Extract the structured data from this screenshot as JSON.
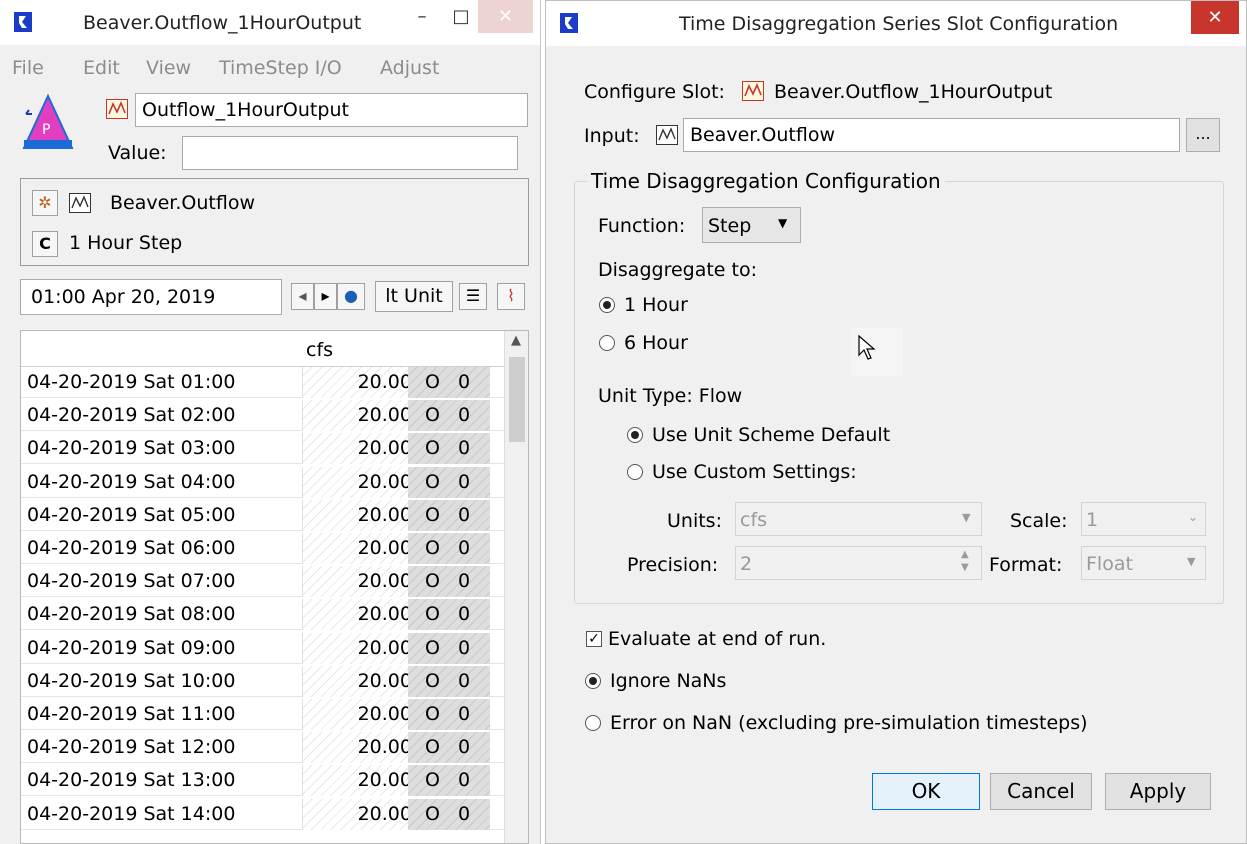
{
  "left_window": {
    "title": "Beaver.Outflow_1HourOutput",
    "controls": {
      "minimize": "–",
      "maximize": "□",
      "close": "✕"
    },
    "menu": [
      "File",
      "Edit",
      "View",
      "TimeStep I/O",
      "Adjust"
    ],
    "slot_name": "Outflow_1HourOutput",
    "value_label": "Value:",
    "value": "",
    "source_slot": "Beaver.Outflow",
    "timestep": "1 Hour Step",
    "date": "01:00 Apr 20, 2019",
    "alt_unit_button": "lt Unit",
    "icons": [
      "gear-icon",
      "series-slot-icon",
      "refresh-icon",
      "nav-left-icon",
      "nav-right-icon",
      "globe-icon",
      "list-icon",
      "plot-icon"
    ],
    "grid": {
      "unit_header": "cfs",
      "rows": [
        {
          "date": "04-20-2019 Sat 01:00",
          "value": "20.00",
          "flag1": "O",
          "flag2": "0"
        },
        {
          "date": "04-20-2019 Sat 02:00",
          "value": "20.00",
          "flag1": "O",
          "flag2": "0"
        },
        {
          "date": "04-20-2019 Sat 03:00",
          "value": "20.00",
          "flag1": "O",
          "flag2": "0"
        },
        {
          "date": "04-20-2019 Sat 04:00",
          "value": "20.00",
          "flag1": "O",
          "flag2": "0"
        },
        {
          "date": "04-20-2019 Sat 05:00",
          "value": "20.00",
          "flag1": "O",
          "flag2": "0"
        },
        {
          "date": "04-20-2019 Sat 06:00",
          "value": "20.00",
          "flag1": "O",
          "flag2": "0"
        },
        {
          "date": "04-20-2019 Sat 07:00",
          "value": "20.00",
          "flag1": "O",
          "flag2": "0"
        },
        {
          "date": "04-20-2019 Sat 08:00",
          "value": "20.00",
          "flag1": "O",
          "flag2": "0"
        },
        {
          "date": "04-20-2019 Sat 09:00",
          "value": "20.00",
          "flag1": "O",
          "flag2": "0"
        },
        {
          "date": "04-20-2019 Sat 10:00",
          "value": "20.00",
          "flag1": "O",
          "flag2": "0"
        },
        {
          "date": "04-20-2019 Sat 11:00",
          "value": "20.00",
          "flag1": "O",
          "flag2": "0"
        },
        {
          "date": "04-20-2019 Sat 12:00",
          "value": "20.00",
          "flag1": "O",
          "flag2": "0"
        },
        {
          "date": "04-20-2019 Sat 13:00",
          "value": "20.00",
          "flag1": "O",
          "flag2": "0"
        },
        {
          "date": "04-20-2019 Sat 14:00",
          "value": "20.00",
          "flag1": "O",
          "flag2": "0"
        }
      ]
    }
  },
  "dialog": {
    "title": "Time Disaggregation Series Slot Configuration",
    "close": "✕",
    "configure_label": "Configure Slot:",
    "configure_slot": "Beaver.Outflow_1HourOutput",
    "input_label": "Input:",
    "input_value": "Beaver.Outflow",
    "browse_button": "...",
    "group_title": "Time Disaggregation Configuration",
    "function_label": "Function:",
    "function_value": "Step",
    "disaggregate_label": "Disaggregate to:",
    "disaggregate_options": [
      {
        "label": "1 Hour",
        "selected": true
      },
      {
        "label": "6 Hour",
        "selected": false
      }
    ],
    "unit_type_label": "Unit Type: Flow",
    "unit_options": [
      {
        "label": "Use Unit Scheme Default",
        "selected": true
      },
      {
        "label": "Use Custom Settings:",
        "selected": false
      }
    ],
    "units_label": "Units:",
    "units_value": "cfs",
    "scale_label": "Scale:",
    "scale_value": "1",
    "precision_label": "Precision:",
    "precision_value": "2",
    "format_label": "Format:",
    "format_value": "Float",
    "evaluate_label": "Evaluate at end of run.",
    "evaluate_checked": true,
    "nan_options": [
      {
        "label": "Ignore NaNs",
        "selected": true
      },
      {
        "label": "Error on NaN  (excluding pre-simulation timesteps)",
        "selected": false
      }
    ],
    "buttons": {
      "ok": "OK",
      "cancel": "Cancel",
      "apply": "Apply"
    }
  },
  "colors": {
    "accent": "#0078d7",
    "close_button": "#c7352c",
    "logo_blue": "#1a3cc8",
    "series_icon_red": "#c0392b",
    "reservoir_pink": "#e040c0",
    "reservoir_blue": "#1a6cd6"
  }
}
